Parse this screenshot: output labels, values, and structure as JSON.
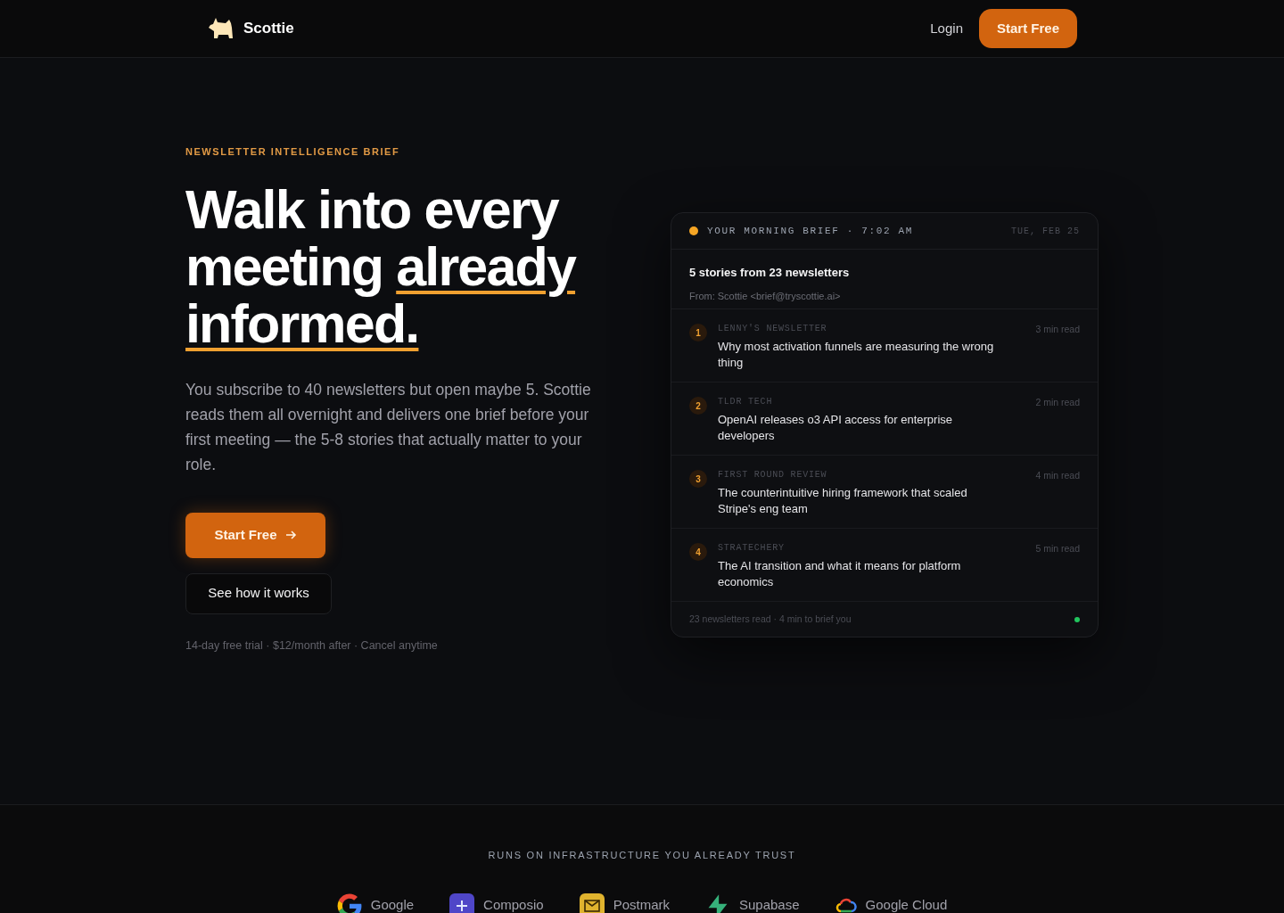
{
  "nav": {
    "brand": "Scottie",
    "login": "Login",
    "cta": "Start Free"
  },
  "hero": {
    "eyebrow": "NEWSLETTER INTELLIGENCE BRIEF",
    "headline_plain": "Walk into every meeting",
    "headline_underlined": "already informed.",
    "body": "You subscribe to 40 newsletters but open maybe 5. Scottie reads them all overnight and delivers one brief before your first meeting — the 5-8 stories that actually matter to your role.",
    "primary_button": "Start Free",
    "secondary_button": "See how it works",
    "fineprint": "14-day free trial · $12/month after · Cancel anytime"
  },
  "brief": {
    "header": "YOUR MORNING BRIEF · 7:02 AM",
    "date": "TUE, FEB 25",
    "title": "5 stories from 23 newsletters",
    "from": "From: Scottie <brief@tryscottie.ai>",
    "stories": [
      {
        "number": "1",
        "source": "LENNY'S NEWSLETTER",
        "headline": "Why most activation funnels are measuring the wrong thing",
        "read_time": "3 min read"
      },
      {
        "number": "2",
        "source": "TLDR TECH",
        "headline": "OpenAI releases o3 API access for enterprise developers",
        "read_time": "2 min read"
      },
      {
        "number": "3",
        "source": "FIRST ROUND REVIEW",
        "headline": "The counterintuitive hiring framework that scaled Stripe's eng team",
        "read_time": "4 min read"
      },
      {
        "number": "4",
        "source": "STRATECHERY",
        "headline": "The AI transition and what it means for platform economics",
        "read_time": "5 min read"
      }
    ],
    "footer": "23 newsletters read · 4 min to brief you"
  },
  "infrastructure": {
    "heading": "RUNS ON INFRASTRUCTURE YOU ALREADY TRUST",
    "logos": [
      {
        "kind": "google",
        "name": "Google"
      },
      {
        "kind": "composio",
        "name": "Composio"
      },
      {
        "kind": "postmark",
        "name": "Postmark"
      },
      {
        "kind": "supabase",
        "name": "Supabase"
      },
      {
        "kind": "cloud",
        "name": "Google Cloud"
      }
    ]
  }
}
